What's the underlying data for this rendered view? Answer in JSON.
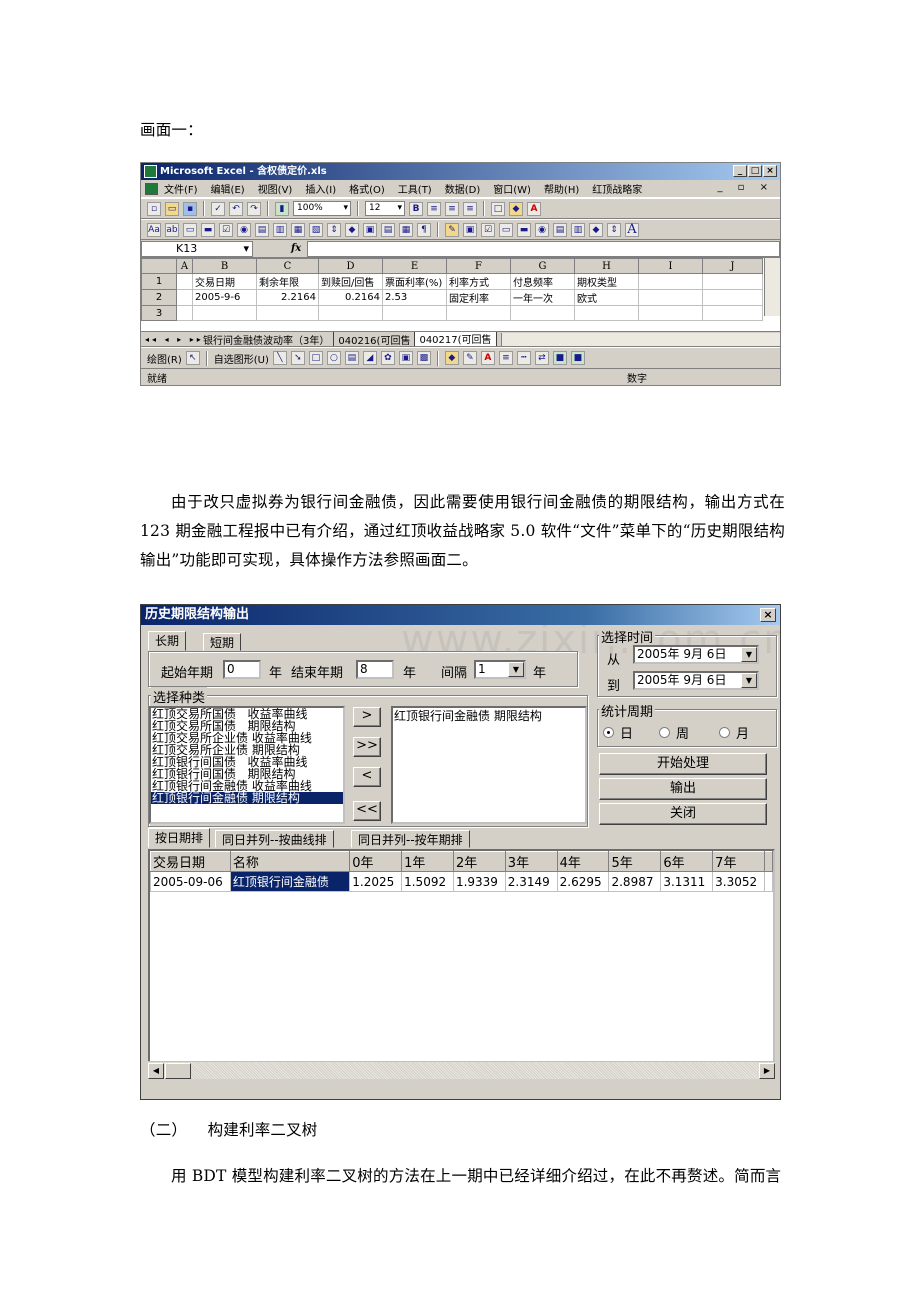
{
  "doc": {
    "caption1": "画面一：",
    "para1": "由于改只虚拟券为银行间金融债，因此需要使用银行间金融债的期限结构，输出方式在123 期金融工程报中已有介绍，通过红顶收益战略家 5.0 软件“文件”菜单下的“历史期限结构输出”功能即可实现，具体操作方法参照画面二。",
    "heading2": "（二）    构建利率二叉树",
    "para2": "用 BDT 模型构建利率二叉树的方法在上一期中已经详细介绍过，在此不再赘述。简而言"
  },
  "excel": {
    "title": "Microsoft Excel - 含权债定价.xls",
    "menu": [
      "文件(F)",
      "编辑(E)",
      "视图(V)",
      "插入(I)",
      "格式(O)",
      "工具(T)",
      "数据(D)",
      "窗口(W)",
      "帮助(H)",
      "红顶战略家"
    ],
    "zoom": "100%",
    "font_size": "12",
    "name_box": "K13",
    "fx": "fx",
    "columns": [
      "A",
      "B",
      "C",
      "D",
      "E",
      "F",
      "G",
      "H",
      "I",
      "J"
    ],
    "rows": [
      {
        "n": "1",
        "cells": [
          "",
          "交易日期",
          "剩余年限",
          "到赎回/回售",
          "票面利率(%)",
          "利率方式",
          "付息频率",
          "期权类型",
          "",
          ""
        ]
      },
      {
        "n": "2",
        "cells": [
          "",
          "2005-9-6",
          "2.2164",
          "0.2164",
          "2.53",
          "固定利率",
          "一年一次",
          "欧式",
          "",
          ""
        ]
      },
      {
        "n": "3",
        "cells": [
          "",
          "",
          "",
          "",
          "",
          "",
          "",
          "",
          "",
          ""
        ]
      }
    ],
    "sheets": [
      "银行间金融债波动率（3年）",
      "040216(可回售",
      "040217(可回售"
    ],
    "drawing_label": "绘图(R)",
    "autoshape_label": "自选图形(U)",
    "status_left": "就绪",
    "status_right": "数字"
  },
  "dialog": {
    "title": "历史期限结构输出",
    "tabs": [
      "长期",
      "短期"
    ],
    "start_year_label": "起始年期",
    "start_year_value": "0",
    "year_unit": "年",
    "end_year_label": "结束年期",
    "end_year_value": "8",
    "interval_label": "间隔",
    "interval_value": "1",
    "category_label": "选择种类",
    "categories": [
      "红顶交易所国债   收益率曲线",
      "红顶交易所国债   期限结构",
      "红顶交易所企业债 收益率曲线",
      "红顶交易所企业债 期限结构",
      "红顶银行间国债   收益率曲线",
      "红顶银行间国债   期限结构",
      "红顶银行间金融债 收益率曲线",
      "红顶银行间金融债 期限结构"
    ],
    "selected_list": [
      "红顶银行间金融债 期限结构"
    ],
    "move_buttons": [
      ">",
      ">>",
      "<",
      "<<"
    ],
    "time_label": "选择时间",
    "from_label": "从",
    "from_date": "2005年 9月 6日",
    "to_label": "到",
    "to_date": "2005年 9月 6日",
    "period_label": "统计周期",
    "period_options": [
      "日",
      "周",
      "月"
    ],
    "start_button": "开始处理",
    "output_button": "输出",
    "close_button": "关闭",
    "result_tabs": [
      "按日期排",
      "同日并列--按曲线排",
      "同日并列--按年期排"
    ],
    "table_headers": [
      "交易日期",
      "名称",
      "0年",
      "1年",
      "2年",
      "3年",
      "4年",
      "5年",
      "6年",
      "7年"
    ],
    "table_rows": [
      [
        "2005-09-06",
        "红顶银行间金融债",
        "1.2025",
        "1.5092",
        "1.9339",
        "2.3149",
        "2.6295",
        "2.8987",
        "3.1311",
        "3.3052"
      ]
    ],
    "watermark": "www.zixin.com.cn"
  }
}
